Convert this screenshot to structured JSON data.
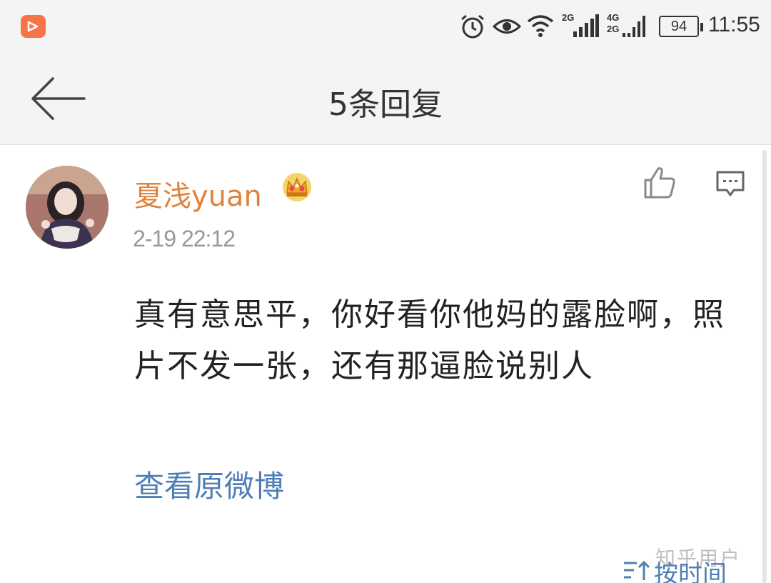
{
  "status_bar": {
    "network_1": "2G",
    "network_2a": "4G",
    "network_2b": "2G",
    "battery": "94",
    "time": "11:55",
    "icons": [
      "app-notification-icon",
      "alarm-icon",
      "eye-icon",
      "wifi-icon",
      "signal-icon",
      "signal-icon"
    ]
  },
  "header": {
    "title": "5条回复",
    "back_icon": "arrow-left-icon"
  },
  "comment": {
    "username": "夏浅yuan",
    "timestamp": "2-19 22:12",
    "text": "真有意思平，你好看你他妈的露脸啊，照片不发一张，还有那逼脸说别人",
    "view_original": "查看原微博",
    "username_color": "#e0823a",
    "link_color": "#4f7fb4",
    "icons": [
      "crown-icon",
      "thumbs-up-icon",
      "reply-icon"
    ]
  },
  "footer": {
    "sort_label": "按时间",
    "watermark": "知乎用户"
  }
}
